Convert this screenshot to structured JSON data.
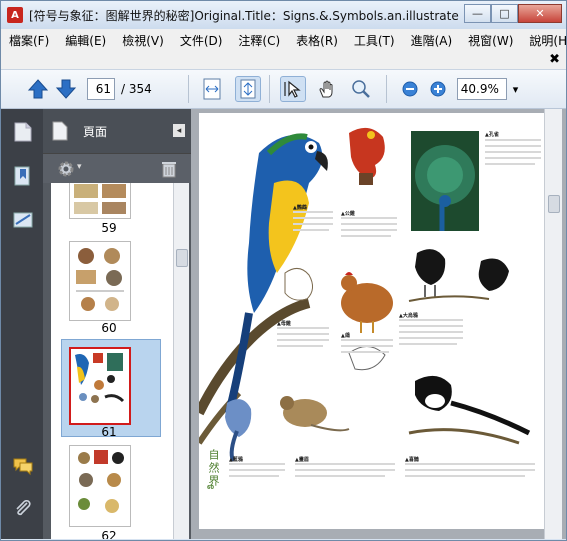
{
  "window": {
    "title": "[符号与象征：图解世界的秘密]Original.Title：Signs.&.Symbols.an.illustrate...",
    "app_icon_glyph": "A",
    "minimize_glyph": "—",
    "maximize_glyph": "□",
    "close_glyph": "✕"
  },
  "menu": [
    "檔案(F)",
    "編輯(E)",
    "檢視(V)",
    "文件(D)",
    "注釋(C)",
    "表格(R)",
    "工具(T)",
    "進階(A)",
    "視窗(W)",
    "說明(H)"
  ],
  "docbar": {
    "close_glyph": "✖"
  },
  "toolbar": {
    "current_page": "61",
    "total_pages": "/ 354",
    "zoom": "40.9%",
    "zoom_dropdown_glyph": "▾"
  },
  "panel": {
    "title": "頁面",
    "collapse_glyph": "◂",
    "options_glyph": "▾",
    "thumbnails": [
      {
        "label": "59"
      },
      {
        "label": "60"
      },
      {
        "label": "61"
      },
      {
        "label": "62"
      }
    ]
  },
  "page": {
    "section_vertical": "自然界",
    "captions": {
      "macaw": "▲鸚鵡",
      "rooster": "▲公雞",
      "peacock": "▲孔雀",
      "crow": "▲大烏鴉",
      "hen": "▲母雞",
      "dove": "▲鴿",
      "jay": "▲藍鴉",
      "thrush": "▲畫眉",
      "magpie": "▲喜鵲"
    },
    "page_number": "60"
  },
  "colors": {
    "rail": "#3c4047",
    "panel": "#555a61",
    "selection": "#b9d4ee",
    "accent_red": "#c8261e",
    "nav_arrow": "#2c6fc4"
  }
}
